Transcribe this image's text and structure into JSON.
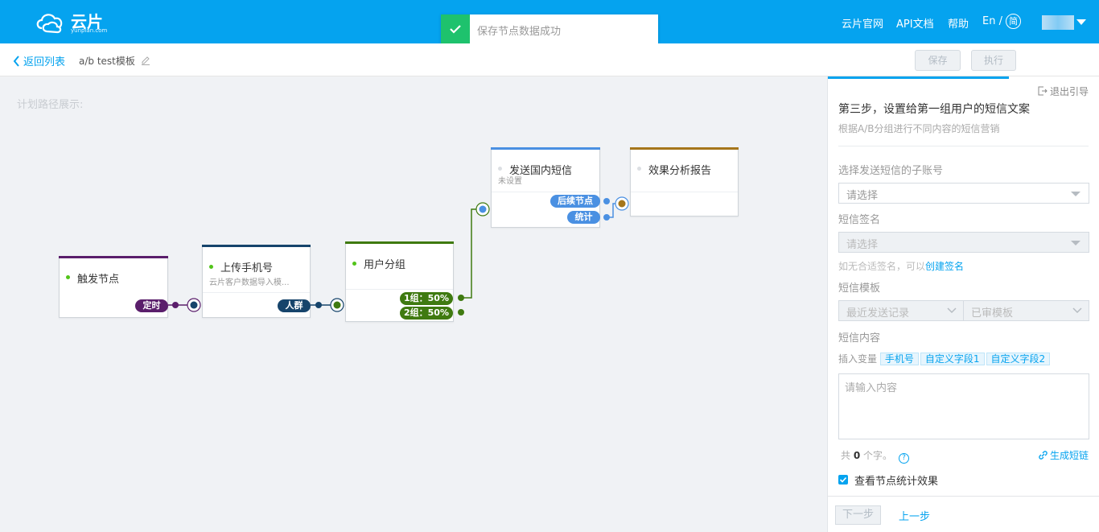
{
  "header": {
    "logo_text": "云片",
    "logo_sub": "yunpian.com",
    "toast": "保存节点数据成功",
    "nav": {
      "site": "云片官网",
      "api": "API文档",
      "help": "帮助",
      "lang_en": "En /",
      "lang_zh": "简"
    }
  },
  "toolbar": {
    "back": "返回列表",
    "template_name": "a/b test模板",
    "save": "保存",
    "run": "执行"
  },
  "canvas": {
    "path_label": "计划路径展示:",
    "nodes": {
      "trigger": {
        "title": "触发节点",
        "port": "定时"
      },
      "upload": {
        "title": "上传手机号",
        "sub": "云片客户数据导入模...",
        "port": "人群"
      },
      "group": {
        "title": "用户分组",
        "port1": "1组：50%",
        "port2": "2组：50%"
      },
      "sms": {
        "title": "发送国内短信",
        "sub": "未设置",
        "port1": "后续节点",
        "port2": "统计"
      },
      "report": {
        "title": "效果分析报告"
      }
    }
  },
  "panel": {
    "exit": "退出引导",
    "step_title": "第三步，设置给第一组用户的短信文案",
    "step_sub": "根据A/B分组进行不同内容的短信营销",
    "account_label": "选择发送短信的子账号",
    "account_placeholder": "请选择",
    "sign_label": "短信签名",
    "sign_placeholder": "请选择",
    "sign_hint": "如无合适签名，可以",
    "sign_hint_link": "创建签名",
    "template_label": "短信模板",
    "template_recent": "最近发送记录",
    "template_approved": "已审模板",
    "content_label": "短信内容",
    "insert_var": "插入变量",
    "vars": [
      "手机号",
      "自定义字段1",
      "自定义字段2"
    ],
    "content_placeholder": "请输入内容",
    "count_prefix": "共",
    "count_value": "0",
    "count_suffix": "个字。",
    "shortlink": "生成短链",
    "check_label": "查看节点统计效果",
    "next": "下一步",
    "prev": "上一步"
  },
  "colors": {
    "brand": "#05a3ef",
    "trigger": "#5a1e6b",
    "upload": "#16446b",
    "group": "#3f7a10",
    "sms": "#4a90e2",
    "report": "#a5761b",
    "success": "#1ec26d"
  }
}
